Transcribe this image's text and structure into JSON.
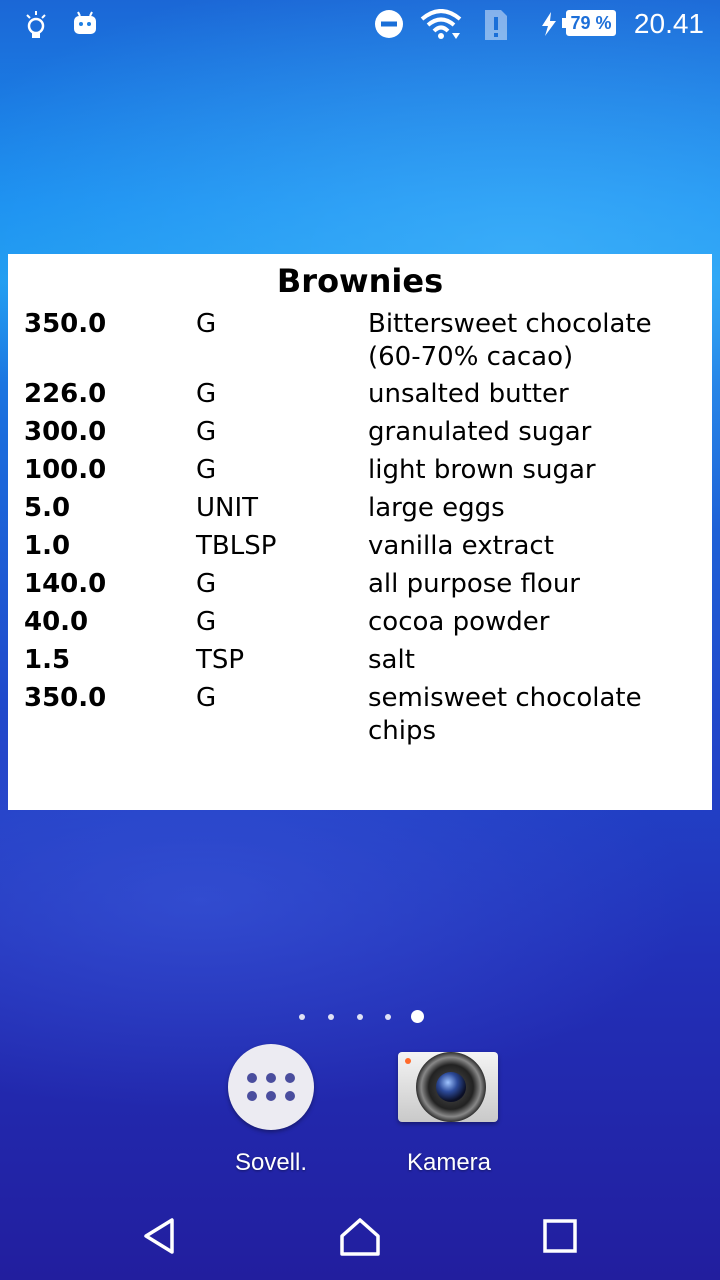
{
  "status_bar": {
    "time": "20.41",
    "battery": "79 %",
    "icons": [
      "lightbulb-icon",
      "android-icon",
      "do-not-disturb-icon",
      "wifi-icon",
      "sim-alert-icon",
      "charging-icon",
      "battery-icon"
    ]
  },
  "widget": {
    "title": "Brownies",
    "ingredients": [
      {
        "qty": "350.0",
        "unit": "G",
        "name": "Bittersweet chocolate (60-70% cacao)"
      },
      {
        "qty": "226.0",
        "unit": "G",
        "name": "unsalted butter"
      },
      {
        "qty": "300.0",
        "unit": "G",
        "name": "granulated sugar"
      },
      {
        "qty": "100.0",
        "unit": "G",
        "name": "light brown sugar"
      },
      {
        "qty": "5.0",
        "unit": "UNIT",
        "name": "large eggs"
      },
      {
        "qty": "1.0",
        "unit": "TBLSP",
        "name": "vanilla extract"
      },
      {
        "qty": "140.0",
        "unit": "G",
        "name": "all purpose flour"
      },
      {
        "qty": "40.0",
        "unit": "G",
        "name": "cocoa powder"
      },
      {
        "qty": "1.5",
        "unit": "TSP",
        "name": "salt"
      },
      {
        "qty": "350.0",
        "unit": "G",
        "name": "semisweet chocolate chips"
      }
    ]
  },
  "home": {
    "page_count": 5,
    "active_page": 5
  },
  "dock": {
    "apps_label": "Sovell.",
    "camera_label": "Kamera"
  },
  "nav": {
    "icons": [
      "back-icon",
      "home-icon",
      "recents-icon"
    ]
  },
  "colors": {
    "widget_background": "#ffffff",
    "text": "#000000",
    "apps_dot": "#4a4d9e"
  }
}
